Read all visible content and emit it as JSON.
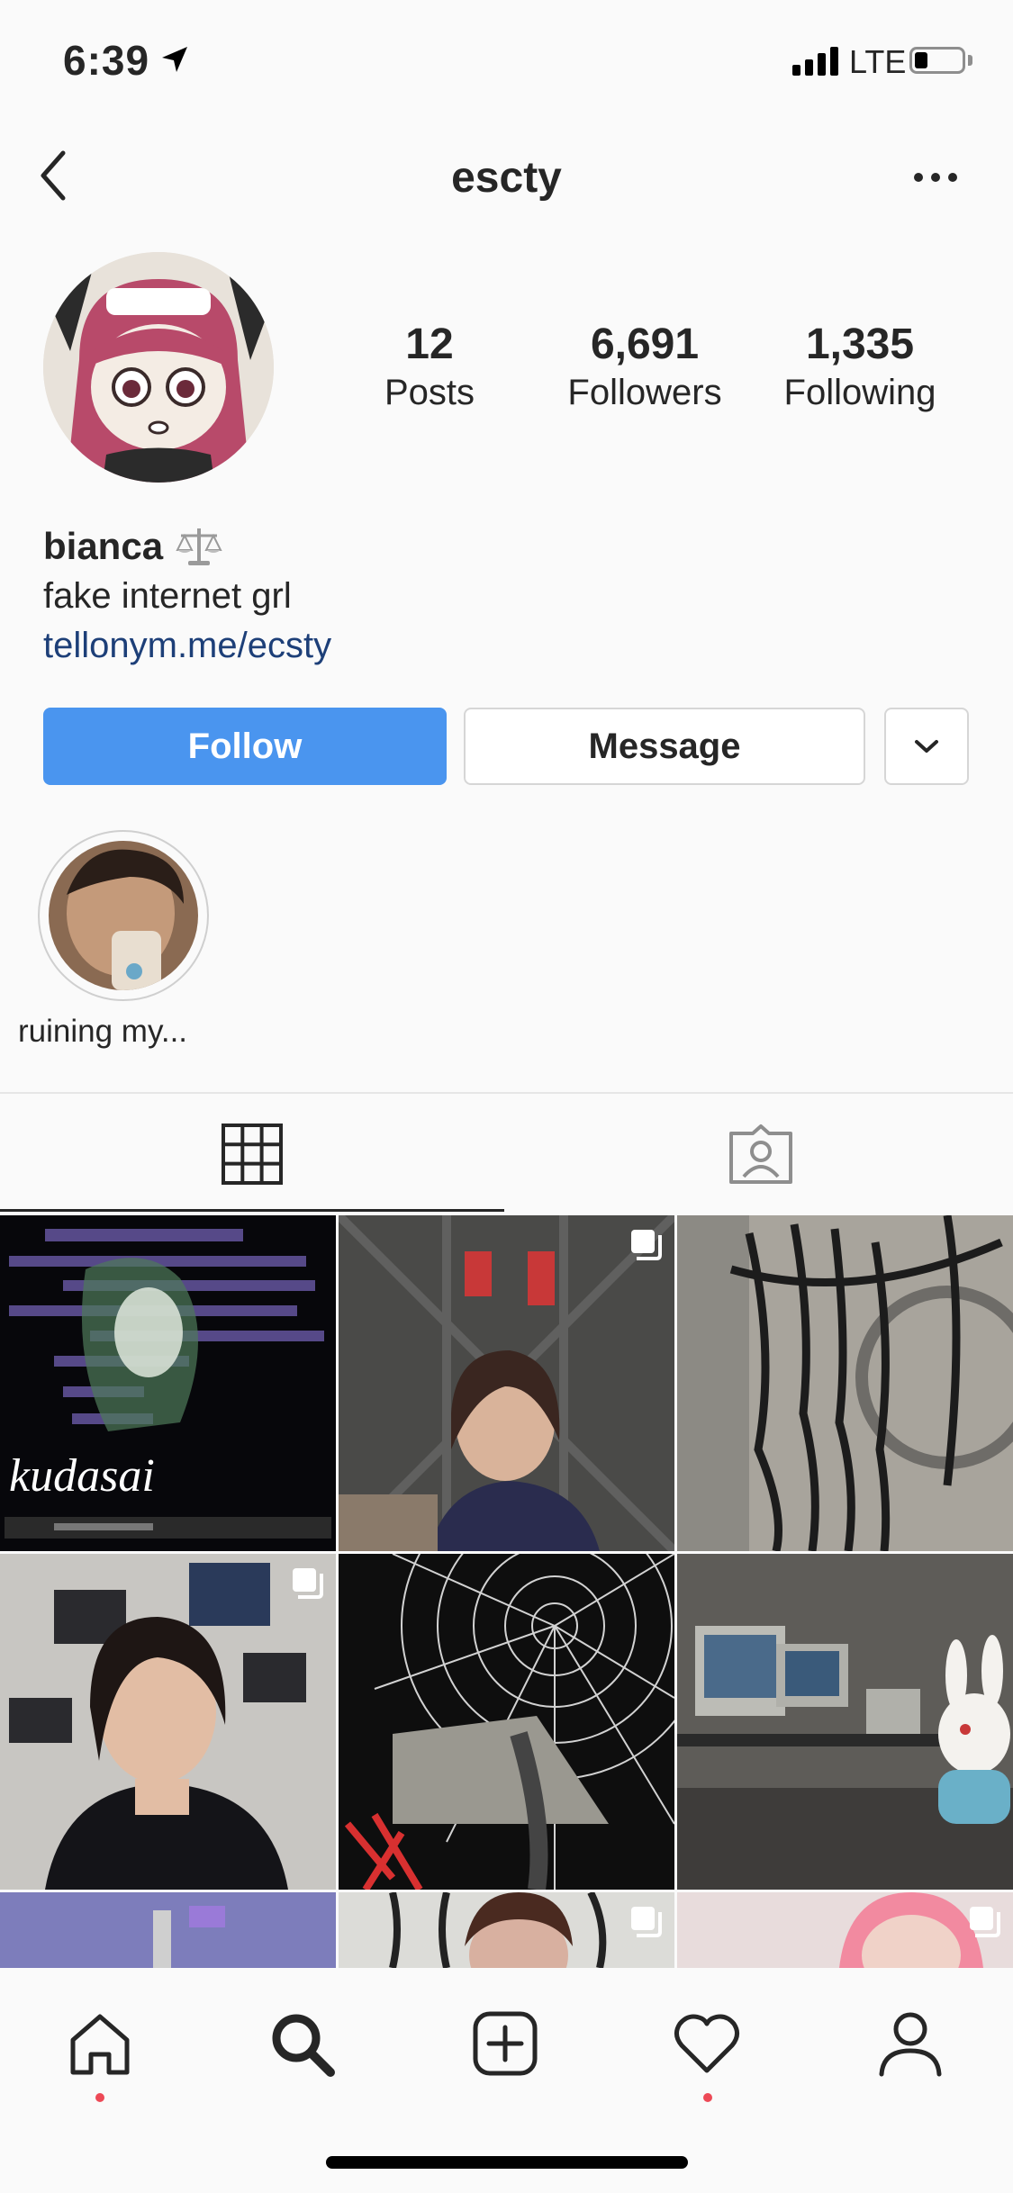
{
  "status_bar": {
    "time": "6:39",
    "network": "LTE",
    "location-icon": "location-arrow-icon"
  },
  "header": {
    "username": "escty",
    "back_icon": "chevron-left-icon",
    "more_icon": "more-horizontal-icon"
  },
  "profile": {
    "stats": [
      {
        "value": "12",
        "label": "Posts"
      },
      {
        "value": "6,691",
        "label": "Followers"
      },
      {
        "value": "1,335",
        "label": "Following"
      }
    ],
    "name": "bianca",
    "name_emoji": "⚖️",
    "bio": "fake internet grl",
    "link": "tellonym.me/ecsty"
  },
  "actions": {
    "follow_label": "Follow",
    "message_label": "Message",
    "dropdown_icon": "chevron-down-icon"
  },
  "highlights": [
    {
      "label": "ruining my..."
    }
  ],
  "tabs": [
    {
      "name": "grid",
      "icon": "grid-icon",
      "active": true
    },
    {
      "name": "tagged",
      "icon": "tagged-person-icon",
      "active": false
    }
  ],
  "posts": {
    "tile1_caption": "kudasai"
  },
  "bottom_nav": [
    {
      "name": "home",
      "icon": "home-icon",
      "notification": true
    },
    {
      "name": "search",
      "icon": "search-icon",
      "notification": false
    },
    {
      "name": "add",
      "icon": "add-post-icon",
      "notification": false
    },
    {
      "name": "activity",
      "icon": "heart-icon",
      "notification": true
    },
    {
      "name": "profile",
      "icon": "profile-icon",
      "notification": false
    }
  ],
  "colors": {
    "accent": "#4a95ef",
    "link": "#1d3f78",
    "notification": "#ed4956"
  }
}
